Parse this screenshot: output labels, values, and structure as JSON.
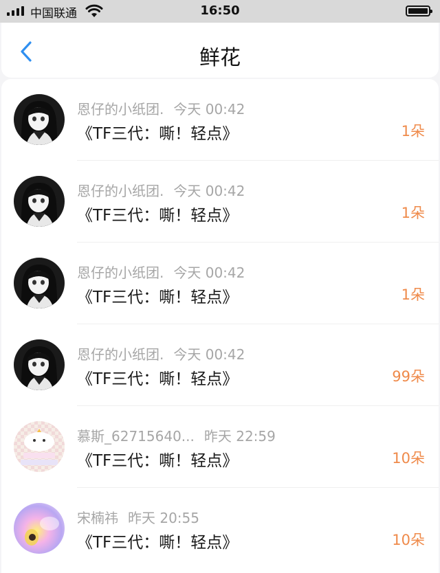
{
  "status_bar": {
    "carrier": "中国联通",
    "time": "16:50"
  },
  "nav": {
    "title": "鲜花",
    "back_icon": "chevron-left-icon",
    "accent_color": "#2f8ff0"
  },
  "colors": {
    "count": "#ef8a4a",
    "meta": "#a6a6a6"
  },
  "items": [
    {
      "user": "恩仔的小纸团.",
      "time": "今天 00:42",
      "gift": "《TF三代：嘶！轻点》",
      "count": "1朵",
      "avatar": "anime-girl-avatar"
    },
    {
      "user": "恩仔的小纸团.",
      "time": "今天 00:42",
      "gift": "《TF三代：嘶！轻点》",
      "count": "1朵",
      "avatar": "anime-girl-avatar"
    },
    {
      "user": "恩仔的小纸团.",
      "time": "今天 00:42",
      "gift": "《TF三代：嘶！轻点》",
      "count": "1朵",
      "avatar": "anime-girl-avatar"
    },
    {
      "user": "恩仔的小纸团.",
      "time": "今天 00:42",
      "gift": "《TF三代：嘶！轻点》",
      "count": "99朵",
      "avatar": "anime-girl-avatar"
    },
    {
      "user": "慕斯_62715640...",
      "time": "昨天 22:59",
      "gift": "《TF三代：嘶！轻点》",
      "count": "10朵",
      "avatar": "cartoon-cloud-avatar"
    },
    {
      "user": "宋楠祎",
      "time": "昨天 20:55",
      "gift": "《TF三代：嘶！轻点》",
      "count": "10朵",
      "avatar": "colorful-blur-avatar"
    }
  ]
}
